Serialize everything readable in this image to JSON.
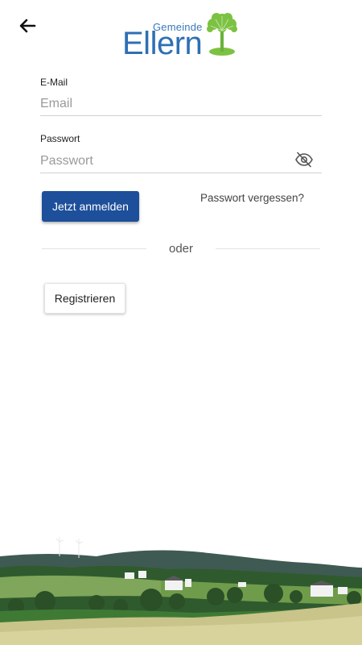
{
  "header": {
    "back_icon": "arrow-left-icon",
    "logo": {
      "small_text": "Gemeinde",
      "big_text": "Ellern",
      "icon": "tree-icon"
    }
  },
  "form": {
    "email": {
      "label": "E-Mail",
      "placeholder": "Email",
      "value": ""
    },
    "password": {
      "label": "Passwort",
      "placeholder": "Passwort",
      "value": "",
      "toggle_icon": "eye-off-icon"
    },
    "login_label": "Jetzt anmelden",
    "forgot_label": "Passwort vergessen?",
    "or_label": "oder",
    "register_label": "Registrieren"
  },
  "colors": {
    "primary": "#1d4f9a",
    "logo_blue": "#2e6fb4",
    "tree_green": "#7cc242"
  },
  "footer": {
    "image": "village-landscape-image"
  }
}
